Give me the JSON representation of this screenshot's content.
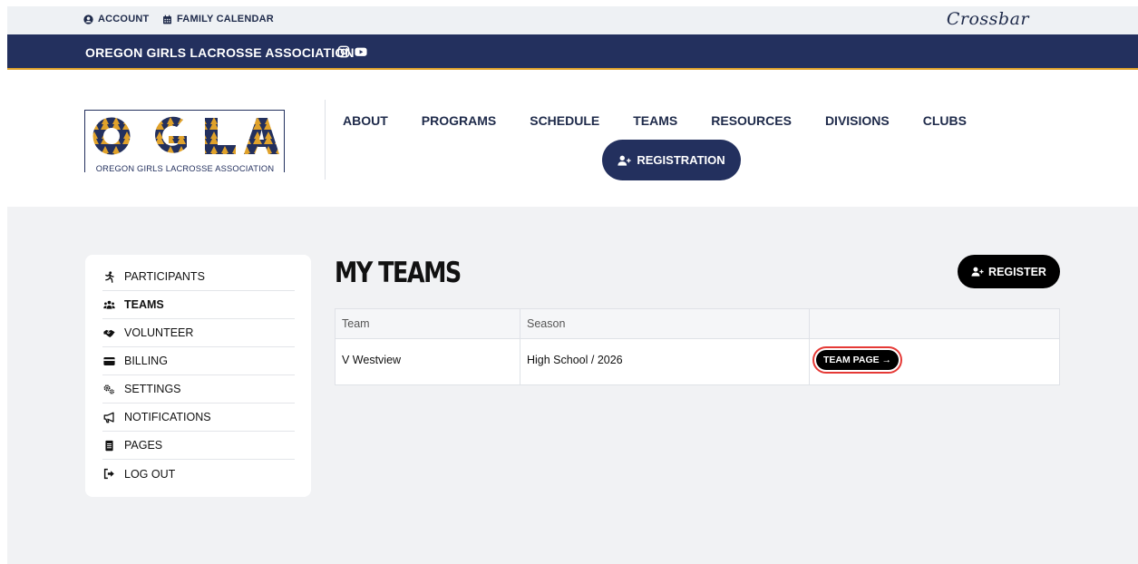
{
  "topbar": {
    "account": "ACCOUNT",
    "calendar": "FAMILY CALENDAR",
    "brand": "Crossbar"
  },
  "org": {
    "title": "OREGON GIRLS LACROSSE ASSOCIATION"
  },
  "logo": {
    "letters": "OGLA",
    "subtitle": "OREGON GIRLS LACROSSE ASSOCIATION"
  },
  "nav": {
    "items": [
      "ABOUT",
      "PROGRAMS",
      "SCHEDULE",
      "TEAMS",
      "RESOURCES",
      "DIVISIONS",
      "CLUBS"
    ],
    "registration": "REGISTRATION"
  },
  "sidebar": {
    "items": [
      {
        "label": "PARTICIPANTS",
        "icon": "running-person-icon",
        "active": false
      },
      {
        "label": "TEAMS",
        "icon": "users-icon",
        "active": true
      },
      {
        "label": "VOLUNTEER",
        "icon": "handshake-icon",
        "active": false
      },
      {
        "label": "BILLING",
        "icon": "credit-card-icon",
        "active": false
      },
      {
        "label": "SETTINGS",
        "icon": "gears-icon",
        "active": false
      },
      {
        "label": "NOTIFICATIONS",
        "icon": "megaphone-icon",
        "active": false
      },
      {
        "label": "PAGES",
        "icon": "file-icon",
        "active": false
      },
      {
        "label": "LOG OUT",
        "icon": "logout-icon",
        "active": false
      }
    ]
  },
  "main": {
    "title": "MY TEAMS",
    "register": "REGISTER",
    "table": {
      "headers": [
        "Team",
        "Season",
        ""
      ],
      "rows": [
        {
          "team": "V Westview",
          "season": "High School / 2026",
          "action": "TEAM PAGE →"
        }
      ]
    }
  },
  "colors": {
    "navy": "#23305e",
    "gold": "#e0a22b",
    "highlight": "#e53935"
  }
}
